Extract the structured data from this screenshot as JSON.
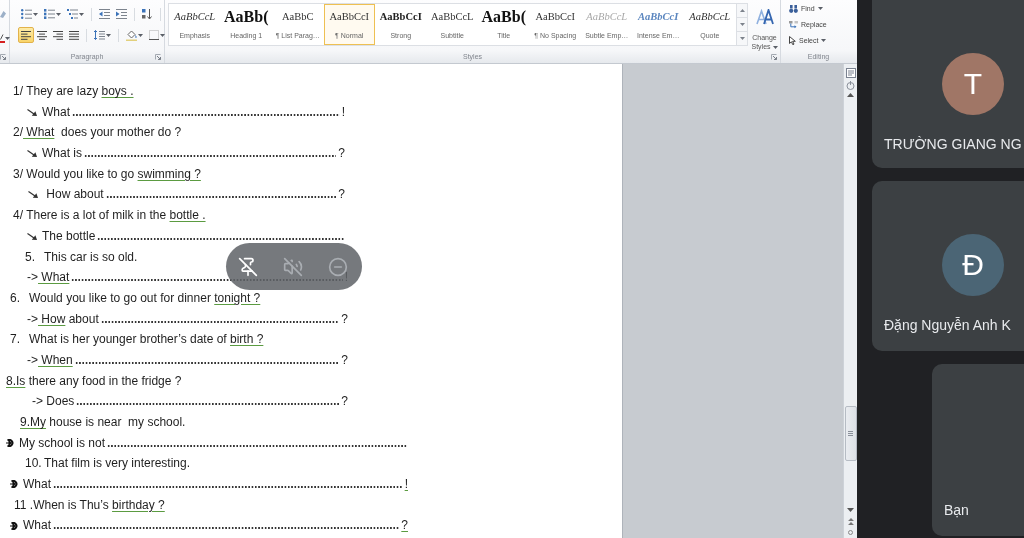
{
  "ribbon": {
    "paragraph": {
      "label": "Paragraph",
      "alignment": [
        {
          "kind": "left",
          "selected": true
        },
        {
          "kind": "center",
          "selected": false
        },
        {
          "kind": "right",
          "selected": false
        },
        {
          "kind": "justify",
          "selected": false
        }
      ]
    },
    "styles": {
      "label": "Styles",
      "gallery": [
        {
          "preview": "AaBbCcL",
          "label": "Emphasis",
          "kind": "italic",
          "selected": false
        },
        {
          "preview": "AaBb(",
          "label": "Heading 1",
          "kind": "heading",
          "selected": false
        },
        {
          "preview": "AaBbC",
          "label": "¶ List Parag…",
          "kind": "plain",
          "selected": false
        },
        {
          "preview": "AaBbCcI",
          "label": "¶ Normal",
          "kind": "plain",
          "selected": true
        },
        {
          "preview": "AaBbCcI",
          "label": "Strong",
          "kind": "bold",
          "selected": false
        },
        {
          "preview": "AaBbCcL",
          "label": "Subtitle",
          "kind": "plain",
          "selected": false
        },
        {
          "preview": "AaBb(",
          "label": "Title",
          "kind": "heading",
          "selected": false
        },
        {
          "preview": "AaBbCcI",
          "label": "¶ No Spacing",
          "kind": "plain",
          "selected": false
        },
        {
          "preview": "AaBbCcL",
          "label": "Subtle Emp…",
          "kind": "subtle",
          "selected": false
        },
        {
          "preview": "AaBbCcI",
          "label": "Intense Em…",
          "kind": "intense",
          "selected": false
        },
        {
          "preview": "AaBbCcL",
          "label": "Quote",
          "kind": "italic",
          "selected": false
        }
      ],
      "change_styles": "Change Styles"
    },
    "editing": {
      "label": "Editing",
      "commands": [
        {
          "kind": "find",
          "label": "Find",
          "dropdown": true
        },
        {
          "kind": "replace",
          "label": "Replace",
          "dropdown": false
        },
        {
          "kind": "select",
          "label": "Select",
          "dropdown": true
        }
      ]
    }
  },
  "document": {
    "lines": [
      {
        "kind": "question",
        "parts": [
          {
            "text": "1/ They are lazy ",
            "marked": false
          },
          {
            "text": "boys .",
            "marked": true
          }
        ]
      },
      {
        "kind": "answer",
        "bullet": {
          "kind": "arrow"
        },
        "parts": [
          {
            "text": "What",
            "marked": false
          }
        ],
        "end": {
          "text": "!",
          "marked": false
        }
      },
      {
        "kind": "question",
        "parts": [
          {
            "text": "2/",
            "marked": false
          },
          {
            "text": " What",
            "marked": true
          },
          {
            "text": "  does your mother do ?",
            "marked": false
          }
        ]
      },
      {
        "kind": "answer",
        "bullet": {
          "kind": "arrow"
        },
        "parts": [
          {
            "text": "What is",
            "marked": false
          }
        ],
        "end": {
          "text": "?",
          "marked": false
        }
      },
      {
        "kind": "question",
        "parts": [
          {
            "text": "3/ Would you like to go ",
            "marked": false
          },
          {
            "text": "swimming ?",
            "marked": true
          }
        ]
      },
      {
        "kind": "answer",
        "bullet": {
          "kind": "arrow"
        },
        "parts": [
          {
            "text": " How about",
            "marked": false
          }
        ],
        "end": {
          "text": "?",
          "marked": false
        }
      },
      {
        "kind": "question",
        "parts": [
          {
            "text": "4/ There is a lot of milk in the ",
            "marked": false
          },
          {
            "text": "bottle .",
            "marked": true
          }
        ]
      },
      {
        "kind": "answer",
        "bullet": {
          "kind": "arrow"
        },
        "parts": [
          {
            "text": "The bottle",
            "marked": false
          }
        ]
      },
      {
        "kind": "question",
        "number": "5.",
        "parts": [
          {
            "text": "This car is so old.",
            "marked": false
          }
        ]
      },
      {
        "kind": "answer",
        "parts": [
          {
            "text": "->",
            "marked": false
          },
          {
            "text": " What",
            "marked": true
          }
        ],
        "end": {
          "text": "!",
          "marked": false
        }
      },
      {
        "kind": "question",
        "number": "6.",
        "parts": [
          {
            "text": "Would you like to go out for dinner ",
            "marked": false
          },
          {
            "text": "tonight ?",
            "marked": true
          }
        ]
      },
      {
        "kind": "answer",
        "parts": [
          {
            "text": "->",
            "marked": false
          },
          {
            "text": " How",
            "marked": true
          },
          {
            "text": " about",
            "marked": false
          }
        ],
        "end": {
          "text": "?",
          "marked": false
        }
      },
      {
        "kind": "question",
        "number": "7.",
        "parts": [
          {
            "text": "What is her younger brother’s date of ",
            "marked": false
          },
          {
            "text": "birth ?",
            "marked": true
          }
        ]
      },
      {
        "kind": "answer",
        "parts": [
          {
            "text": "->",
            "marked": false
          },
          {
            "text": " When",
            "marked": true
          }
        ],
        "end": {
          "text": "?",
          "marked": false
        }
      },
      {
        "kind": "question",
        "parts": [
          {
            "text": "8.Is",
            "marked": true
          },
          {
            "text": " there any food in the fridge ?",
            "marked": false
          }
        ]
      },
      {
        "kind": "answer",
        "parts": [
          {
            "text": "-> Does",
            "marked": false
          }
        ],
        "end": {
          "text": "?",
          "marked": false
        }
      },
      {
        "kind": "question",
        "parts": [
          {
            "text": "9.My",
            "marked": true
          },
          {
            "text": " house is near  my school.",
            "marked": false
          }
        ]
      },
      {
        "kind": "answer",
        "bullet": {
          "kind": "circle"
        },
        "parts": [
          {
            "text": "My school is not",
            "marked": false
          }
        ]
      },
      {
        "kind": "question",
        "number": "10.",
        "parts": [
          {
            "text": "That film is very interesting.",
            "marked": false
          }
        ]
      },
      {
        "kind": "answer",
        "bullet": {
          "kind": "circle"
        },
        "parts": [
          {
            "text": "What",
            "marked": false
          }
        ],
        "end": {
          "text": "!",
          "marked": true
        }
      },
      {
        "kind": "question",
        "parts": [
          {
            "text": "11 .When is Thu’s ",
            "marked": false
          },
          {
            "text": "birthday ?",
            "marked": true
          }
        ]
      },
      {
        "kind": "answer",
        "bullet": {
          "kind": "circle"
        },
        "parts": [
          {
            "text": "What",
            "marked": false
          }
        ],
        "end": {
          "text": "?",
          "marked": true
        }
      }
    ]
  },
  "floating_controls": [
    {
      "kind": "unpin",
      "disabled": false
    },
    {
      "kind": "mute",
      "disabled": true
    },
    {
      "kind": "remove",
      "disabled": true
    }
  ],
  "participants": [
    {
      "kind": "avatar",
      "initial": "T",
      "name": "TRƯỜNG GIANG NG",
      "color": "#a07666"
    },
    {
      "kind": "avatar",
      "initial": "Đ",
      "name": "Đặng Nguyễn Anh K",
      "color": "#4b6575"
    },
    {
      "kind": "self",
      "name": "Bạn"
    }
  ]
}
